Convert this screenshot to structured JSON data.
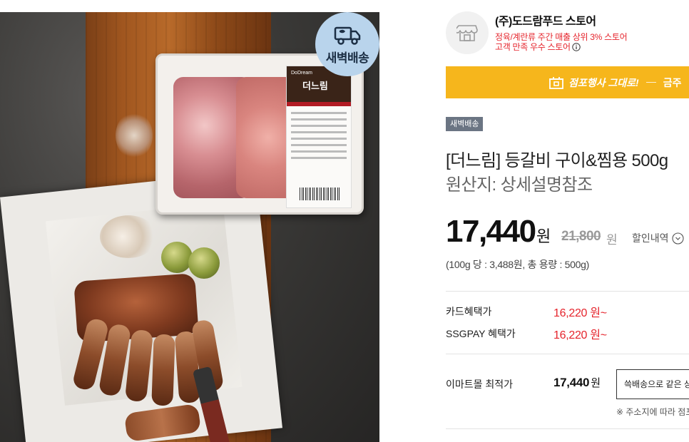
{
  "product_image": {
    "badge_text": "새벽배송",
    "package_brand": "DoDream",
    "package_name": "더느림"
  },
  "store": {
    "name": "(주)도드람푸드 스토어",
    "rank_text": "정육/계란류 주간 매출 상위 3% 스토어",
    "satisfaction_text": "고객 만족 우수 스토어"
  },
  "promo_banner": {
    "label": "점포행사 그대로!",
    "tail_text": "금주"
  },
  "delivery_tag": "새벽배송",
  "product": {
    "title": "[더느림] 등갈비 구이&찜용 500g",
    "origin": "원산지: 상세설명참조"
  },
  "price": {
    "sale": "17,440",
    "sale_unit": "원",
    "original": "21,800",
    "original_unit": "원",
    "discount_link": "할인내역",
    "unit_info": "(100g 당 : 3,488원, 총 용량 : 500g)"
  },
  "benefits": [
    {
      "label": "카드혜택가",
      "value": "16,220 원~"
    },
    {
      "label": "SSGPAY 혜택가",
      "value": "16,220 원~"
    }
  ],
  "best_price": {
    "label": "이마트몰 최적가",
    "value": "17,440",
    "unit": "원",
    "button_label": "쓱배송으로 같은 상품",
    "address_note": "※ 주소지에 따라 점포"
  },
  "colors": {
    "accent_red": "#e5242c",
    "promo_yellow": "#f6b61c",
    "tag_gray": "#6b7583",
    "badge_blue": "#b9d4ec"
  }
}
